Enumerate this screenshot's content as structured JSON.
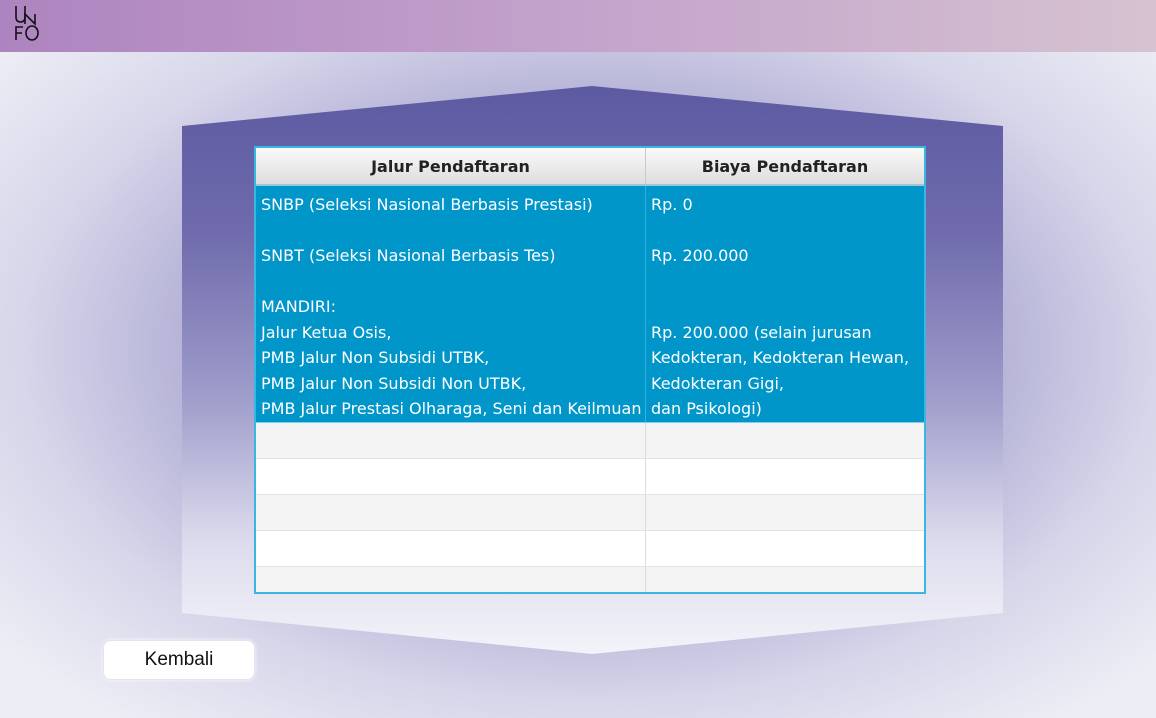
{
  "app": {
    "logo_text": "UNFO"
  },
  "colors": {
    "header_gradient_start": "#ae84c0",
    "header_gradient_end": "#d6c2d0",
    "panel_top": "#5e5aa2",
    "selected_row": "#0096c9",
    "table_border": "#39b7e3"
  },
  "table": {
    "headers": [
      "Jalur Pendaftaran",
      "Biaya Pendaftaran"
    ],
    "selected_row": {
      "jalur": "SNBP (Seleksi Nasional Berbasis Prestasi)\n\nSNBT (Seleksi Nasional Berbasis Tes)\n\nMANDIRI:\nJalur Ketua Osis,\nPMB Jalur Non Subsidi UTBK,\nPMB Jalur Non Subsidi Non UTBK,\nPMB Jalur Prestasi Olharaga, Seni dan Keilmuan",
      "biaya": "Rp. 0\n\nRp. 200.000\n\n\nRp. 200.000 (selain jurusan\nKedokteran, Kedokteran Hewan,\nKedokteran Gigi,\ndan Psikologi)"
    }
  },
  "actions": {
    "back_label": "Kembali"
  }
}
